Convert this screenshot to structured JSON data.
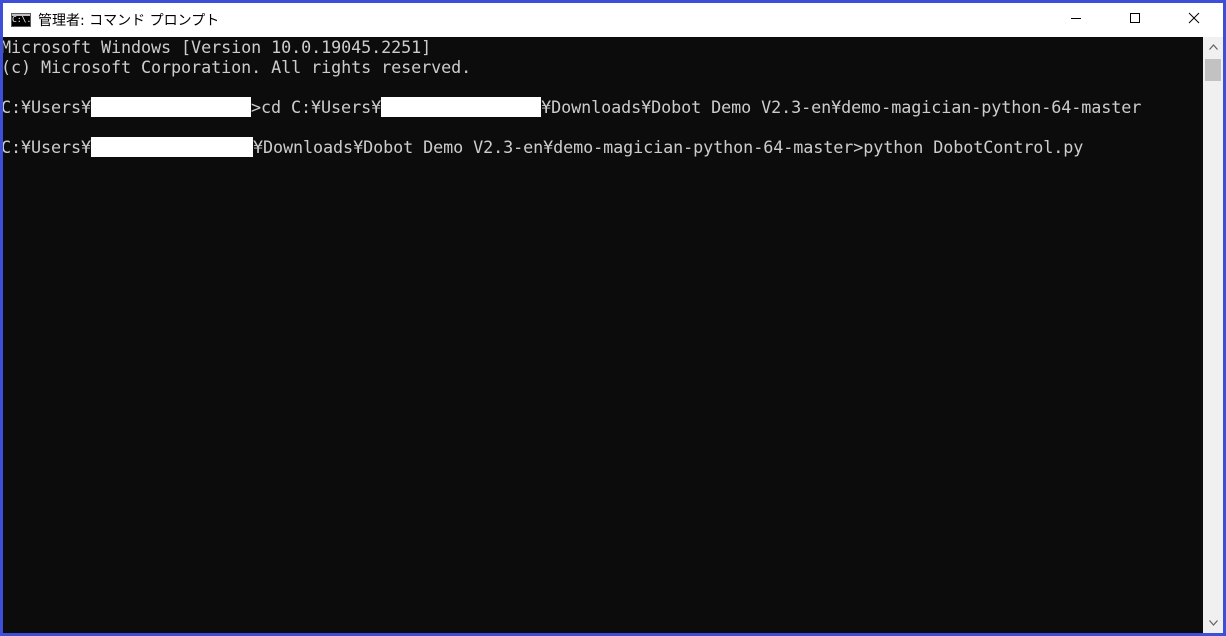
{
  "window": {
    "title": "管理者: コマンド プロンプト",
    "icon_text": "C:\\."
  },
  "console": {
    "lines": [
      "Microsoft Windows [Version 10.0.19045.2251]",
      "(c) Microsoft Corporation. All rights reserved."
    ],
    "cmd1_prefix": "C:¥Users¥",
    "cmd1_mid": ">cd C:¥Users¥",
    "cmd1_suffix": "¥Downloads¥Dobot Demo V2.3-en¥demo-magician-python-64-master",
    "cmd2_prefix": "C:¥Users¥",
    "cmd2_suffix": "¥Downloads¥Dobot Demo V2.3-en¥demo-magician-python-64-master>python DobotControl.py"
  },
  "colors": {
    "console_bg": "#0c0c0c",
    "console_fg": "#cccccc",
    "frame": "#3d4fd6"
  }
}
